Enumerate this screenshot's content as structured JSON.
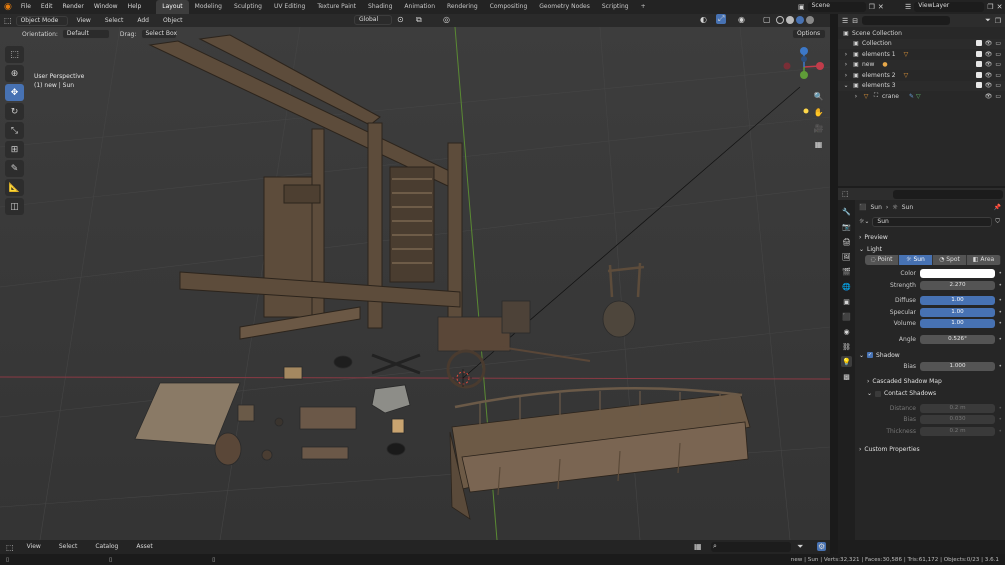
{
  "topbar": {
    "menus": [
      "File",
      "Edit",
      "Render",
      "Window",
      "Help"
    ],
    "workspaces": [
      "Layout",
      "Modeling",
      "Sculpting",
      "UV Editing",
      "Texture Paint",
      "Shading",
      "Animation",
      "Rendering",
      "Compositing",
      "Geometry Nodes",
      "Scripting"
    ],
    "active_workspace": "Layout",
    "scene_name": "Scene",
    "viewlayer_name": "ViewLayer",
    "add_tab": "+"
  },
  "viewport_header": {
    "mode": "Object Mode",
    "menus": [
      "View",
      "Select",
      "Add",
      "Object"
    ],
    "transform_orientation": "Global"
  },
  "tool_settings": {
    "orientation_label": "Orientation:",
    "orientation_value": "Default",
    "drag_label": "Drag:",
    "drag_value": "Select Box",
    "options_label": "Options"
  },
  "viewport": {
    "perspective_label": "User Perspective",
    "selection_info": "(1) new | Sun"
  },
  "asset_bar": {
    "menus": [
      "View",
      "Select",
      "Catalog",
      "Asset"
    ]
  },
  "outliner": {
    "items": [
      {
        "label": "Scene Collection",
        "indent": 0,
        "selected": false
      },
      {
        "label": "Collection",
        "indent": 1,
        "selected": false
      },
      {
        "label": "elements 1",
        "indent": 1,
        "selected": false
      },
      {
        "label": "new",
        "indent": 1,
        "selected": false
      },
      {
        "label": "elements 2",
        "indent": 1,
        "selected": false
      },
      {
        "label": "elements 3",
        "indent": 1,
        "selected": false
      },
      {
        "label": "crane",
        "indent": 2,
        "selected": false
      }
    ]
  },
  "properties": {
    "breadcrumb_object": "Sun",
    "breadcrumb_data": "Sun",
    "datablock_name": "Sun",
    "preview_label": "Preview",
    "light_label": "Light",
    "light_types": [
      "Point",
      "Sun",
      "Spot",
      "Area"
    ],
    "active_light_type": "Sun",
    "color_label": "Color",
    "color_value": "#ffffff",
    "strength_label": "Strength",
    "strength_value": "2.270",
    "diffuse_label": "Diffuse",
    "diffuse_value": "1.00",
    "specular_label": "Specular",
    "specular_value": "1.00",
    "volume_label": "Volume",
    "volume_value": "1.00",
    "angle_label": "Angle",
    "angle_value": "0.526°",
    "shadow_label": "Shadow",
    "bias_label": "Bias",
    "bias_value": "1.000",
    "cascaded_label": "Cascaded Shadow Map",
    "contact_label": "Contact Shadows",
    "distance_label": "Distance",
    "distance_value": "0.2 m",
    "contact_bias_label": "Bias",
    "contact_bias_value": "0.030",
    "thickness_label": "Thickness",
    "thickness_value": "0.2 m",
    "custom_props_label": "Custom Properties"
  },
  "statusbar": {
    "stats": "new | Sun | Verts:32,321 | Faces:30,586 | Tris:61,172 | Objects:0/23 | 3.6.1"
  },
  "colors": {
    "accent": "#4772b3",
    "axis_x": "#c13c4a",
    "axis_y": "#5f9c38",
    "axis_z": "#3c78c8"
  }
}
